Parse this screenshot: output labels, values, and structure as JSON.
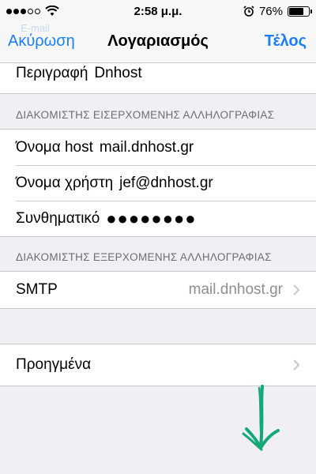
{
  "status_bar": {
    "time": "2:58 μ.μ.",
    "battery": "76%",
    "battery_level": 0.76,
    "signal_bars_on": 3,
    "signal_bars_total": 5
  },
  "nav": {
    "ghost_label": "E-mail",
    "cancel_label": "Ακύρωση",
    "title": "Λογαριασμός",
    "done_label": "Τέλος"
  },
  "description": {
    "label": "Περιγραφή",
    "value": "Dnhost"
  },
  "incoming": {
    "header": "ΔΙΑΚΟΜΙΣΤΗΣ ΕΙΣΕΡΧΟΜΕΝΗΣ ΑΛΛΗΛΟΓΡΑΦΙΑΣ",
    "host_label": "Όνομα host",
    "host_value": "mail.dnhost.gr",
    "user_label": "Όνομα χρήστη",
    "user_value": "jef@dnhost.gr",
    "password_label": "Συνθηματικό",
    "password_value": "●●●●●●●●"
  },
  "outgoing": {
    "header": "ΔΙΑΚΟΜΙΣΤΗΣ ΕΞΕΡΧΟΜΕΝΗΣ ΑΛΛΗΛΟΓΡΑΦΙΑΣ",
    "smtp_label": "SMTP",
    "smtp_value": "mail.dnhost.gr"
  },
  "advanced": {
    "label": "Προηγμένα"
  },
  "colors": {
    "accent": "#1a7ef5",
    "annotation": "#13a876",
    "background": "#efeff4"
  }
}
